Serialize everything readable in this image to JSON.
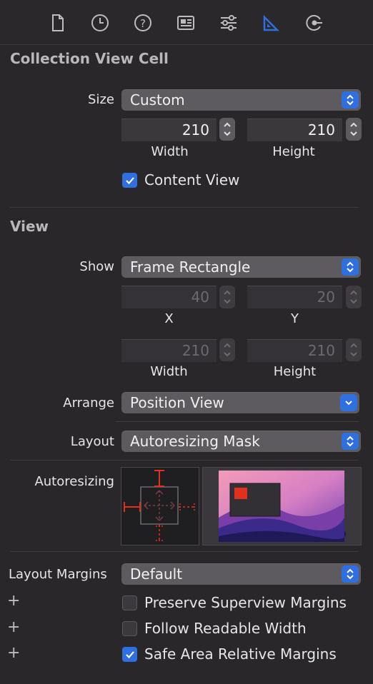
{
  "toolbar": {
    "icons": [
      "file-inspector-icon",
      "history-inspector-icon",
      "quick-help-icon",
      "identity-inspector-icon",
      "attributes-inspector-icon",
      "size-inspector-icon",
      "connections-inspector-icon"
    ],
    "active": "size-inspector-icon",
    "accent": "#2f6fe0"
  },
  "collection_view_cell": {
    "title": "Collection View Cell",
    "size_label": "Size",
    "size_value": "Custom",
    "width_value": "210",
    "height_value": "210",
    "width_label": "Width",
    "height_label": "Height",
    "content_view_label": "Content View",
    "content_view_checked": true
  },
  "view": {
    "title": "View",
    "show_label": "Show",
    "show_value": "Frame Rectangle",
    "x_value": "40",
    "y_value": "20",
    "x_label": "X",
    "y_label": "Y",
    "width_value": "210",
    "height_value": "210",
    "width_label": "Width",
    "height_label": "Height",
    "arrange_label": "Arrange",
    "arrange_value": "Position View",
    "layout_label": "Layout",
    "layout_value": "Autoresizing Mask",
    "autoresizing_label": "Autoresizing",
    "layout_margins_label": "Layout Margins",
    "layout_margins_value": "Default",
    "options": [
      {
        "plus": "+",
        "label": "Preserve Superview Margins",
        "checked": false
      },
      {
        "plus": "+",
        "label": "Follow Readable Width",
        "checked": false
      },
      {
        "plus": "+",
        "label": "Safe Area Relative Margins",
        "checked": true
      }
    ]
  }
}
